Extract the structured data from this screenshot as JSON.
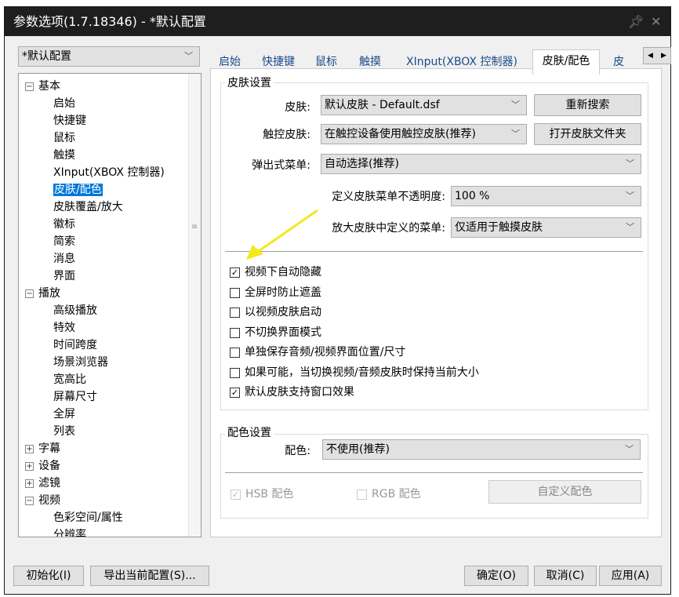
{
  "window": {
    "title": "参数选项(1.7.18346) - *默认配置"
  },
  "profile_select": "*默认配置",
  "tree": [
    {
      "label": "基本",
      "level": 0,
      "expander": "minus"
    },
    {
      "label": "启始",
      "level": 1
    },
    {
      "label": "快捷键",
      "level": 1
    },
    {
      "label": "鼠标",
      "level": 1
    },
    {
      "label": "触摸",
      "level": 1
    },
    {
      "label": "XInput(XBOX 控制器)",
      "level": 1
    },
    {
      "label": "皮肤/配色",
      "level": 1,
      "selected": true
    },
    {
      "label": "皮肤覆盖/放大",
      "level": 1
    },
    {
      "label": "徽标",
      "level": 1
    },
    {
      "label": "简索",
      "level": 1
    },
    {
      "label": "消息",
      "level": 1
    },
    {
      "label": "界面",
      "level": 1
    },
    {
      "label": "播放",
      "level": 0,
      "expander": "minus"
    },
    {
      "label": "高级播放",
      "level": 1
    },
    {
      "label": "特效",
      "level": 1
    },
    {
      "label": "时间跨度",
      "level": 1
    },
    {
      "label": "场景浏览器",
      "level": 1
    },
    {
      "label": "宽高比",
      "level": 1
    },
    {
      "label": "屏幕尺寸",
      "level": 1
    },
    {
      "label": "全屏",
      "level": 1
    },
    {
      "label": "列表",
      "level": 1
    },
    {
      "label": "字幕",
      "level": 0,
      "expander": "plus"
    },
    {
      "label": "设备",
      "level": 0,
      "expander": "plus"
    },
    {
      "label": "滤镜",
      "level": 0,
      "expander": "plus"
    },
    {
      "label": "视频",
      "level": 0,
      "expander": "minus"
    },
    {
      "label": "色彩空间/属性",
      "level": 1
    },
    {
      "label": "分辨率",
      "level": 1
    }
  ],
  "tabs": [
    "启始",
    "快捷键",
    "鼠标",
    "触摸",
    "XInput(XBOX 控制器)",
    "皮肤/配色",
    "皮"
  ],
  "skin": {
    "group_title": "皮肤设置",
    "skin_label": "皮肤:",
    "skin_value": "默认皮肤 - Default.dsf",
    "rescan": "重新搜索",
    "touch_label": "触控皮肤:",
    "touch_value": "在触控设备使用触控皮肤(推荐)",
    "open_folder": "打开皮肤文件夹",
    "popup_label": "弹出式菜单:",
    "popup_value": "自动选择(推荐)",
    "opacity_label": "定义皮肤菜单不透明度:",
    "opacity_value": "100 %",
    "zoom_label": "放大皮肤中定义的菜单:",
    "zoom_value": "仅适用于触摸皮肤",
    "checkboxes": [
      {
        "label": "视频下自动隐藏",
        "checked": true
      },
      {
        "label": "全屏时防止遮盖",
        "checked": false
      },
      {
        "label": "以视频皮肤启动",
        "checked": false
      },
      {
        "label": "不切换界面模式",
        "checked": false
      },
      {
        "label": "单独保存音频/视频界面位置/尺寸",
        "checked": false
      },
      {
        "label": "如果可能，当切换视频/音频皮肤时保持当前大小",
        "checked": false
      },
      {
        "label": "默认皮肤支持窗口效果",
        "checked": true
      }
    ]
  },
  "color": {
    "group_title": "配色设置",
    "label": "配色:",
    "value": "不使用(推荐)",
    "hsb": "HSB 配色",
    "rgb": "RGB 配色",
    "custom": "自定义配色"
  },
  "footer": {
    "init": "初始化(I)",
    "export": "导出当前配置(S)...",
    "ok": "确定(O)",
    "cancel": "取消(C)",
    "apply": "应用(A)"
  },
  "colors": {
    "accent": "#0078d7",
    "arrow": "#f5e81c"
  }
}
